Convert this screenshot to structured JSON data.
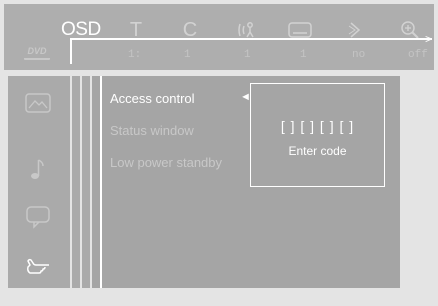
{
  "topbar": {
    "osd_label": "OSD",
    "icons": {
      "title": "T",
      "chapter": "C",
      "audio": "audio-icon",
      "subtitle": "subtitle-icon",
      "angle": "angle-icon",
      "zoom": "zoom-icon"
    },
    "info": {
      "disc_logo": "DVD",
      "title_value": "1:",
      "chapter_value": "1",
      "audio_value": "1",
      "subtitle_value": "1",
      "angle_value": "no",
      "zoom_value": "off"
    }
  },
  "sidebar": {
    "items": [
      {
        "icon": "picture-icon"
      },
      {
        "icon": "music-note-icon"
      },
      {
        "icon": "speech-bubble-icon"
      },
      {
        "icon": "hand-pointer-icon",
        "active": true
      }
    ]
  },
  "menu": {
    "items": [
      {
        "label": "Access control",
        "active": true
      },
      {
        "label": "Status window",
        "active": false
      },
      {
        "label": "Low power standby",
        "active": false
      }
    ],
    "selection_arrow": "◄"
  },
  "code_dialog": {
    "placeholder": "[ ] [ ] [ ] [ ]",
    "label": "Enter code"
  },
  "colors": {
    "background": "#e4e4e4",
    "panel": "#aaaaaa",
    "highlight": "#ffffff",
    "dim_text": "#c8c8c8"
  }
}
